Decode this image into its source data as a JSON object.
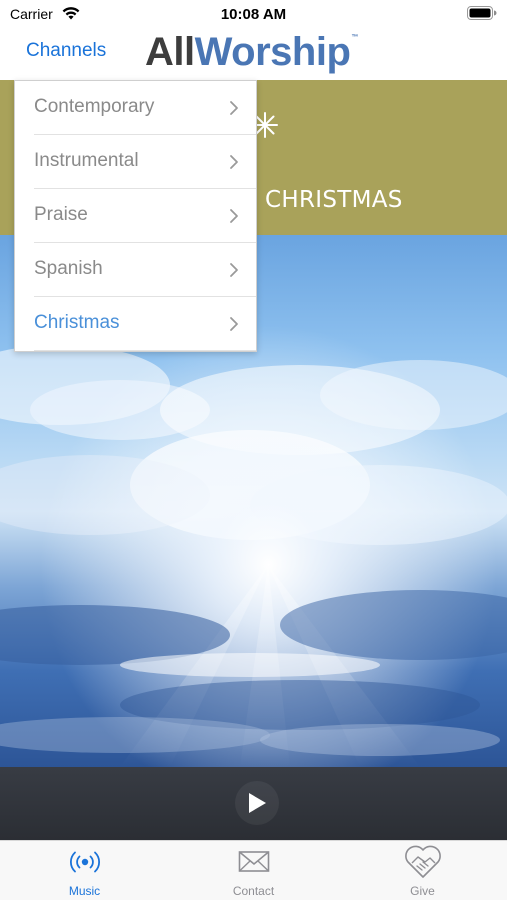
{
  "status_bar": {
    "carrier": "Carrier",
    "time": "10:08 AM",
    "wifi_icon": "wifi-icon",
    "battery_icon": "battery-icon"
  },
  "nav": {
    "channels_label": "Channels",
    "logo": {
      "part1": "All",
      "part2": "Worship",
      "trademark": "™"
    }
  },
  "banner": {
    "title": "CHRISTMAS",
    "icon": "star-burst-icon",
    "color": "#a9a25a"
  },
  "channel_menu": {
    "items": [
      {
        "label": "Contemporary",
        "selected": false
      },
      {
        "label": "Instrumental",
        "selected": false
      },
      {
        "label": "Praise",
        "selected": false
      },
      {
        "label": "Spanish",
        "selected": false
      },
      {
        "label": "Christmas",
        "selected": true
      }
    ]
  },
  "player": {
    "play_icon": "play-icon"
  },
  "tab_bar": {
    "tabs": [
      {
        "label": "Music",
        "icon": "broadcast-icon",
        "active": true
      },
      {
        "label": "Contact",
        "icon": "envelope-icon",
        "active": false
      },
      {
        "label": "Give",
        "icon": "heart-handshake-icon",
        "active": false
      }
    ]
  },
  "colors": {
    "accent": "#1a73d9",
    "menu_selected": "#4a90d9",
    "logo_dark": "#3d3d3d",
    "logo_blue": "#4a76b4"
  }
}
